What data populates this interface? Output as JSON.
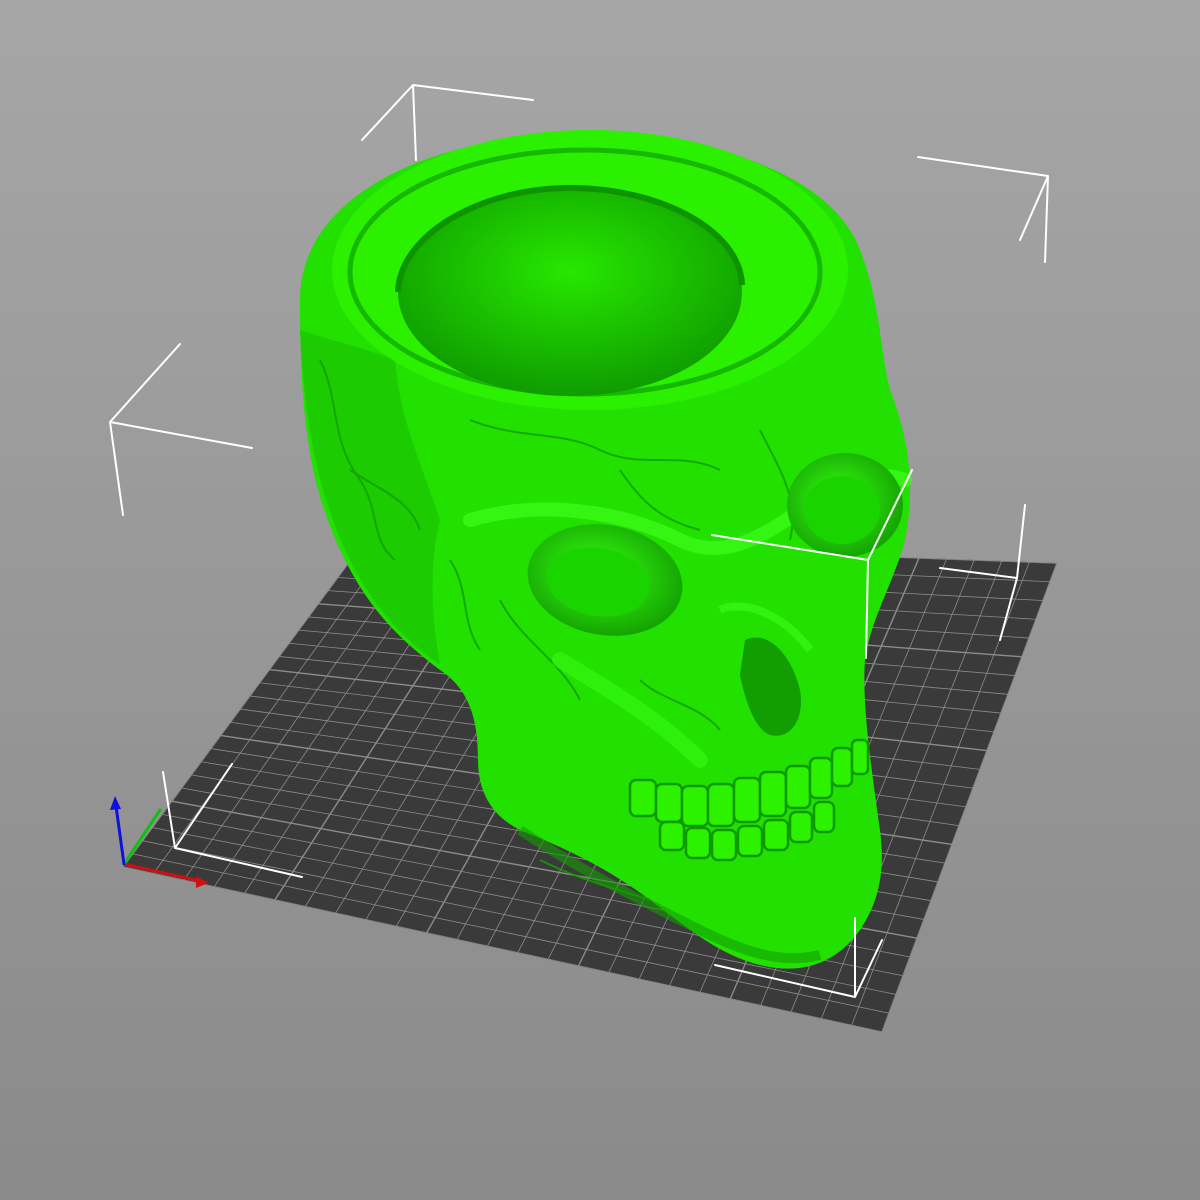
{
  "viewport": {
    "background_top": "#a6a6a6",
    "background_bottom": "#8a8a8a"
  },
  "bed": {
    "fill_color": "#3a3a3a",
    "grid_color": "#8c8c8c",
    "grid_divisions": 25
  },
  "model": {
    "shape": "skull-planter",
    "color": "#22e000",
    "selected": true
  },
  "selection_box": {
    "color": "#ffffff"
  },
  "axes": {
    "x_color": "#d01010",
    "y_color": "#10c010",
    "z_color": "#1010e0"
  }
}
